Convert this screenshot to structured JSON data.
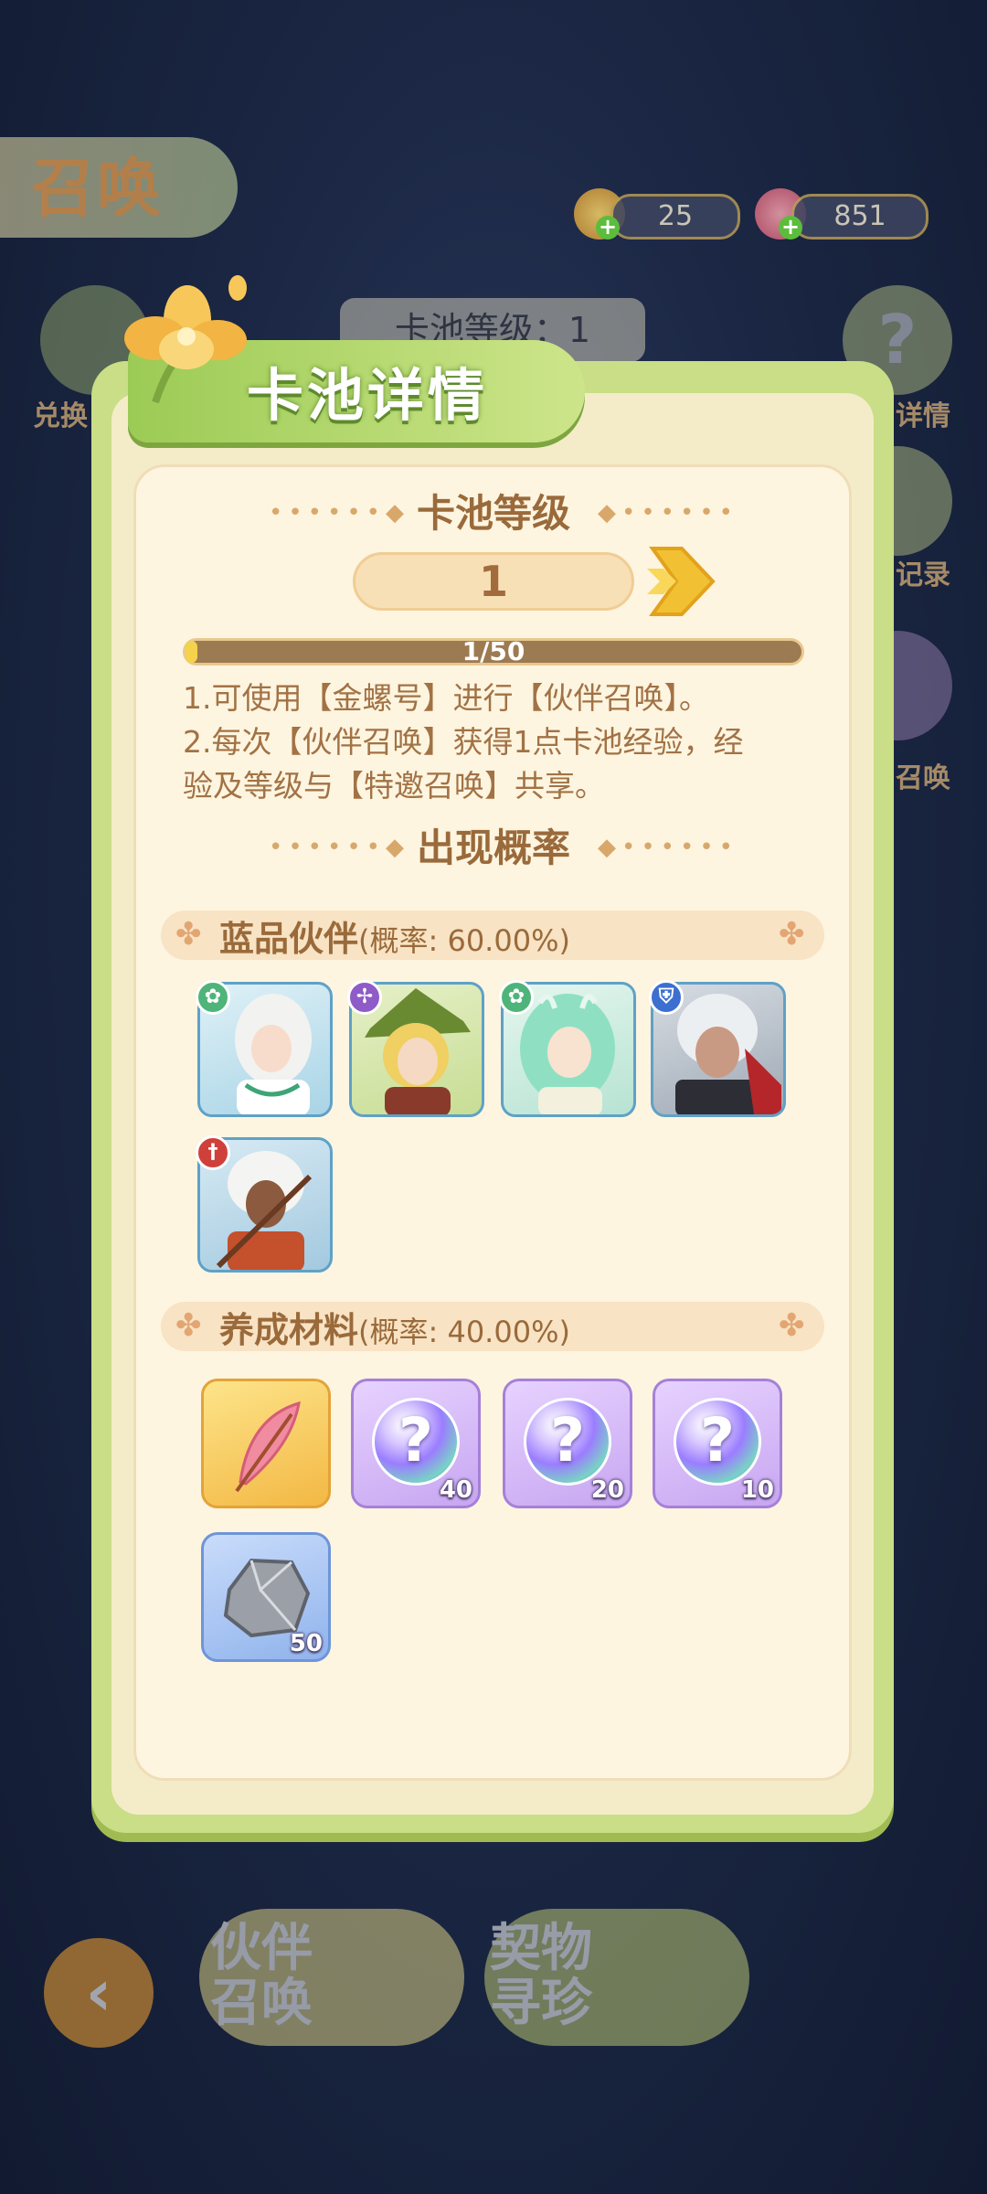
{
  "background": {
    "title": "召唤",
    "currency": [
      {
        "name": "gold-conch",
        "value": "25"
      },
      {
        "name": "gem",
        "value": "851"
      }
    ],
    "left_button_label": "兑换",
    "right_buttons": [
      {
        "label": "详情"
      },
      {
        "label": "记录"
      },
      {
        "label": "召唤"
      }
    ],
    "pool_level": "卡池等级：1",
    "bottom_tabs": [
      {
        "label": "伙伴召唤"
      },
      {
        "label": "契物寻珍"
      }
    ],
    "colors": {
      "accent_green": "#9ccb55",
      "brown": "#9a6a3b",
      "gold": "#f4d24c"
    }
  },
  "modal": {
    "title": "卡池详情",
    "level_section_title": "卡池等级",
    "level_value": "1",
    "progress": {
      "text": "1/50",
      "current": 1,
      "max": 50
    },
    "desc_lines": [
      "1.可使用【金螺号】进行【伙伴召唤】。",
      "2.每次【伙伴召唤】获得1点卡池经验，经",
      "验及等级与【特邀召唤】共享。"
    ],
    "rate_section_title": "出现概率",
    "categories": [
      {
        "name": "蓝品伙伴",
        "rate": "(概率: 60.00%)",
        "characters": [
          {
            "class_icon": "leaf-icon",
            "class_color": "#4fb47a",
            "portrait": "white-haired-elf"
          },
          {
            "class_icon": "crosshair-icon",
            "class_color": "#8e5bc7",
            "portrait": "green-hat-archer"
          },
          {
            "class_icon": "leaf-icon",
            "class_color": "#4fb47a",
            "portrait": "horned-elf"
          },
          {
            "class_icon": "shield-icon",
            "class_color": "#3c6fd0",
            "portrait": "silver-haired-knight"
          },
          {
            "class_icon": "sword-icon",
            "class_color": "#d0403b",
            "portrait": "tribal-warrior"
          }
        ]
      },
      {
        "name": "养成材料",
        "rate": "(概率: 40.00%)",
        "items": [
          {
            "icon": "feather-icon",
            "count": "",
            "frame": "gold"
          },
          {
            "icon": "mystery-orb-icon",
            "count": "40",
            "frame": "purple"
          },
          {
            "icon": "mystery-orb-icon",
            "count": "20",
            "frame": "purple"
          },
          {
            "icon": "mystery-orb-icon",
            "count": "10",
            "frame": "purple"
          },
          {
            "icon": "stone-icon",
            "count": "50",
            "frame": "blue"
          }
        ]
      }
    ]
  }
}
